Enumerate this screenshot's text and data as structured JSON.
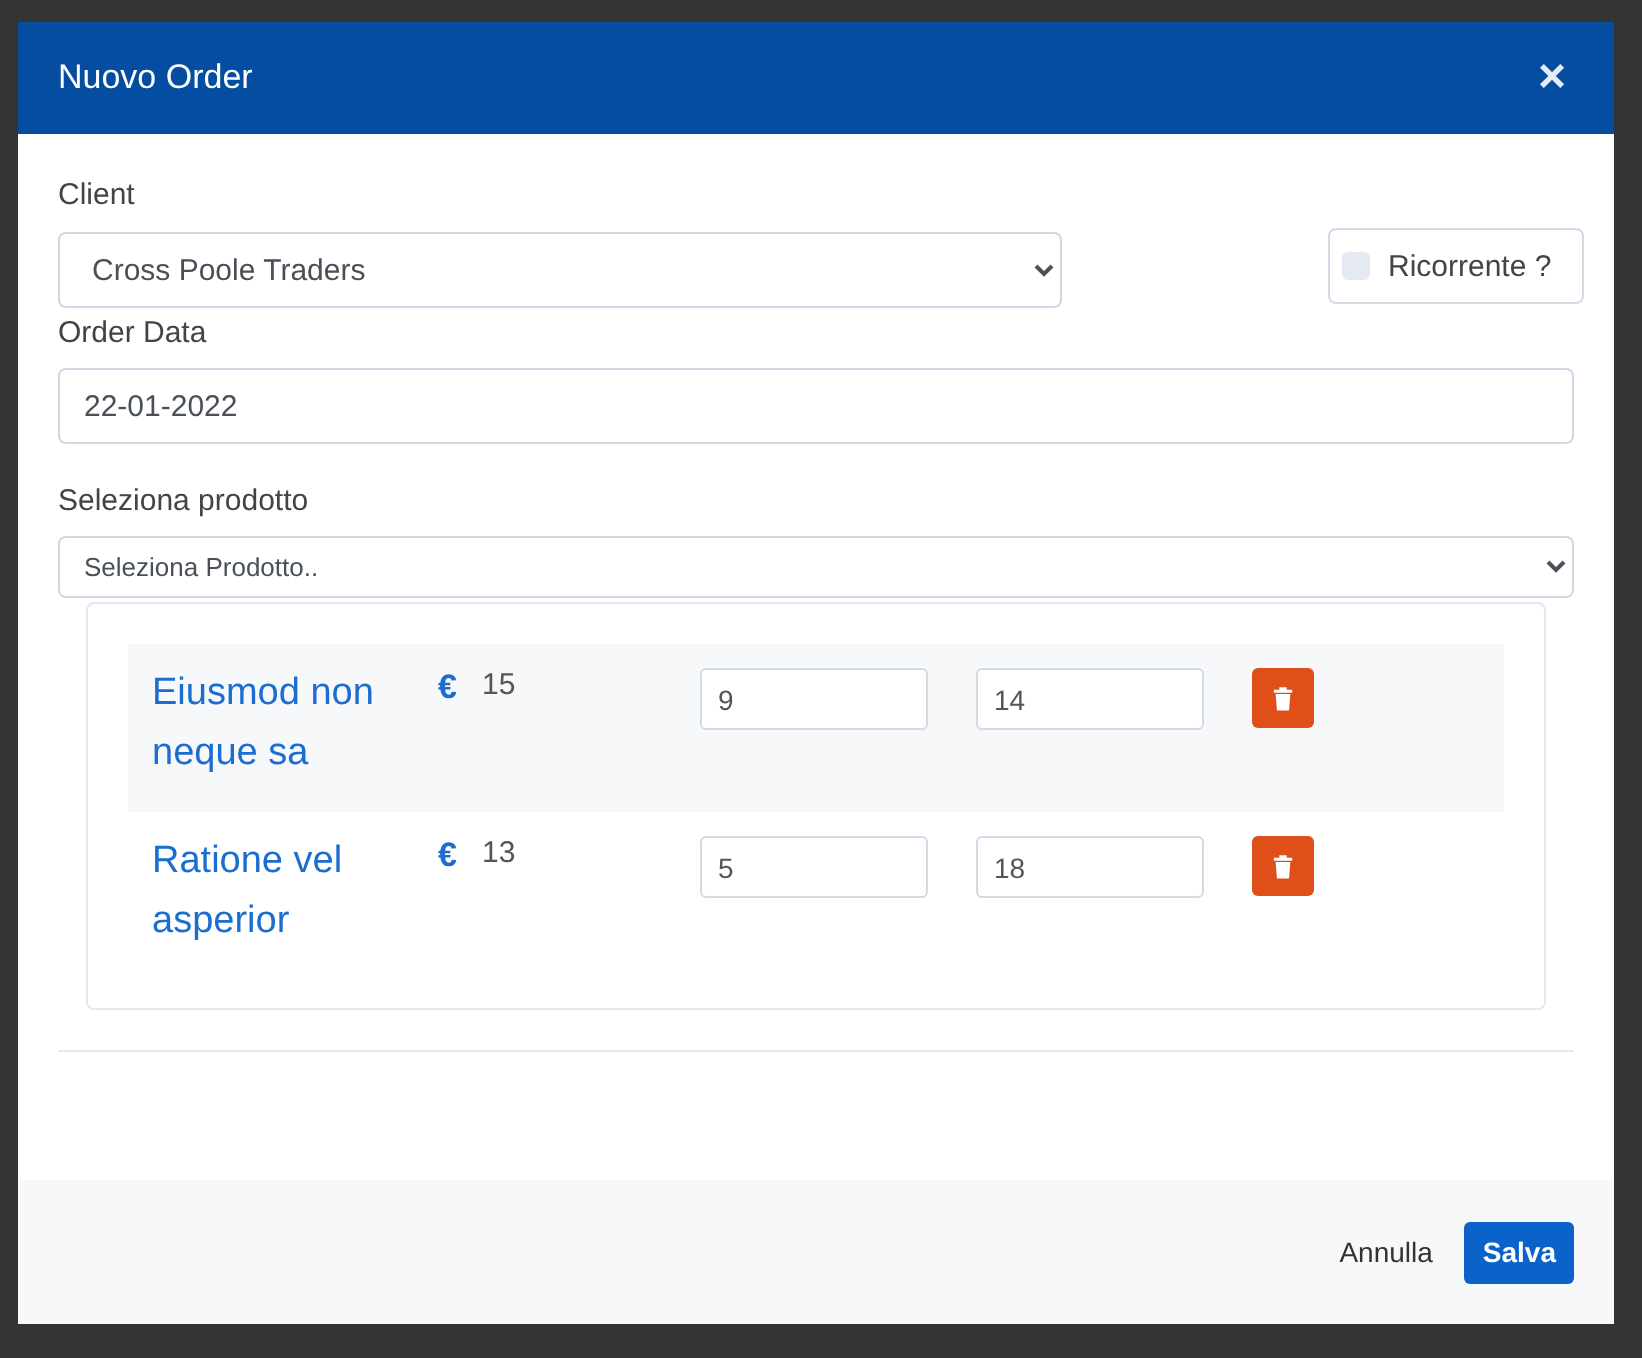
{
  "dialog": {
    "title": "Nuovo Order",
    "close": "×"
  },
  "client": {
    "label": "Client",
    "value": "Cross Poole Traders"
  },
  "recurring": {
    "label": "Ricorrente ?",
    "checked": false
  },
  "order_date": {
    "label": "Order Data",
    "value": "22-01-2022"
  },
  "product_select": {
    "label": "Seleziona prodotto",
    "value": "Seleziona Prodotto.."
  },
  "products": [
    {
      "name": "Eiusmod non neque sa",
      "currency": "€",
      "price": "15",
      "quantity": "9",
      "field_2": "14"
    },
    {
      "name": "Ratione vel asperior",
      "currency": "€",
      "price": "13",
      "quantity": "5",
      "field_2": "18"
    }
  ],
  "buttons": [
    {
      "label": "Annulla",
      "kind": "cancel"
    },
    {
      "label": "Salva",
      "kind": "primary"
    }
  ]
}
